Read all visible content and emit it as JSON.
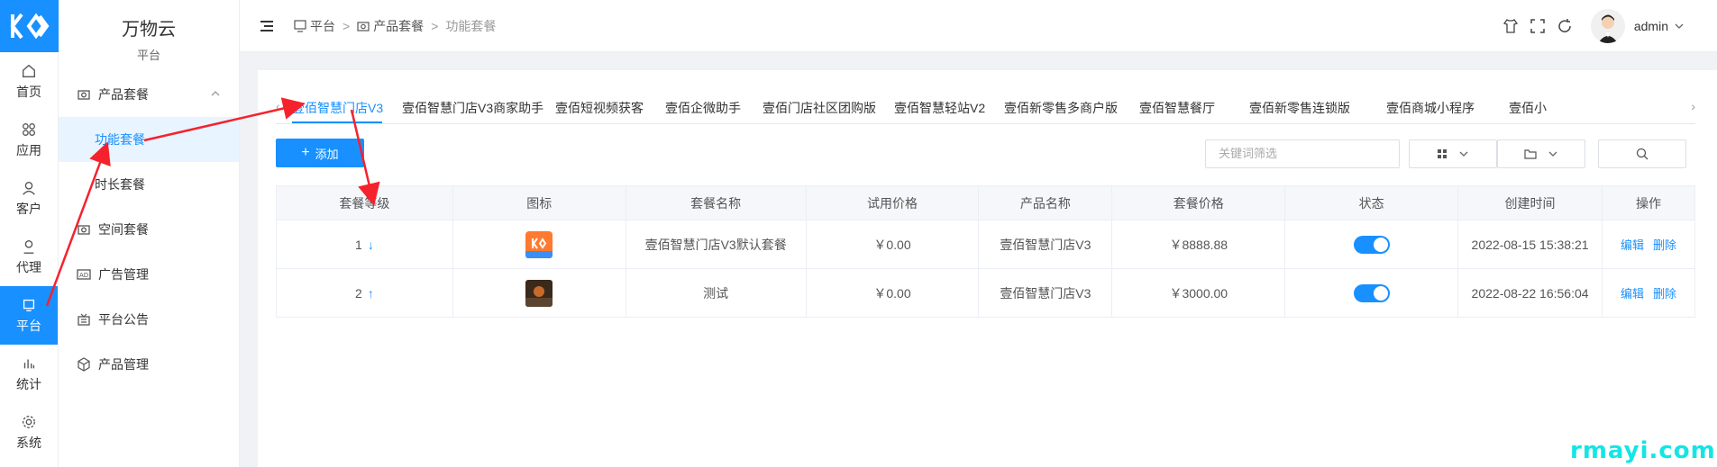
{
  "rail": {
    "items": [
      {
        "label": "首页",
        "icon": "home-icon"
      },
      {
        "label": "应用",
        "icon": "apps-icon"
      },
      {
        "label": "客户",
        "icon": "user-icon"
      },
      {
        "label": "代理",
        "icon": "agent-icon"
      },
      {
        "label": "平台",
        "icon": "monitor-icon",
        "active": true
      },
      {
        "label": "统计",
        "icon": "bar-chart-icon"
      },
      {
        "label": "系统",
        "icon": "gear-icon"
      }
    ]
  },
  "sidebar": {
    "brand_title": "万物云",
    "brand_subtitle": "平台",
    "items": [
      {
        "label": "产品套餐"
      },
      {
        "label": "功能套餐"
      },
      {
        "label": "时长套餐"
      },
      {
        "label": "空间套餐"
      },
      {
        "label": "广告管理"
      },
      {
        "label": "平台公告"
      },
      {
        "label": "产品管理"
      }
    ]
  },
  "header": {
    "breadcrumb": [
      "平台",
      "产品套餐",
      "功能套餐"
    ],
    "user": "admin"
  },
  "tabs": [
    "壹佰智慧门店V3",
    "壹佰智慧门店V3商家助手",
    "壹佰短视频获客",
    "壹佰企微助手",
    "壹佰门店社区团购版",
    "壹佰智慧轻站V2",
    "壹佰新零售多商户版",
    "壹佰智慧餐厅",
    "壹佰新零售连锁版",
    "壹佰商城小程序",
    "壹佰小"
  ],
  "toolbar": {
    "add_label": "添加",
    "search_placeholder": "关键词筛选"
  },
  "table": {
    "headers": [
      "套餐等级",
      "图标",
      "套餐名称",
      "试用价格",
      "产品名称",
      "套餐价格",
      "状态",
      "创建时间",
      "操作"
    ],
    "rows": [
      {
        "level": "1",
        "sort": "↓",
        "name": "壹佰智慧门店V3默认套餐",
        "trial": "￥0.00",
        "product": "壹佰智慧门店V3",
        "price": "￥8888.88",
        "status": "on",
        "created": "2022-08-15 15:38:21",
        "edit": "编辑",
        "delete": "删除"
      },
      {
        "level": "2",
        "sort": "↑",
        "name": "测试",
        "trial": "￥0.00",
        "product": "壹佰智慧门店V3",
        "price": "￥3000.00",
        "status": "on",
        "created": "2022-08-22 16:56:04",
        "edit": "编辑",
        "delete": "删除"
      }
    ]
  },
  "watermark": "rmayi.com",
  "colors": {
    "primary": "#1890ff",
    "annotation": "#f5222d"
  }
}
